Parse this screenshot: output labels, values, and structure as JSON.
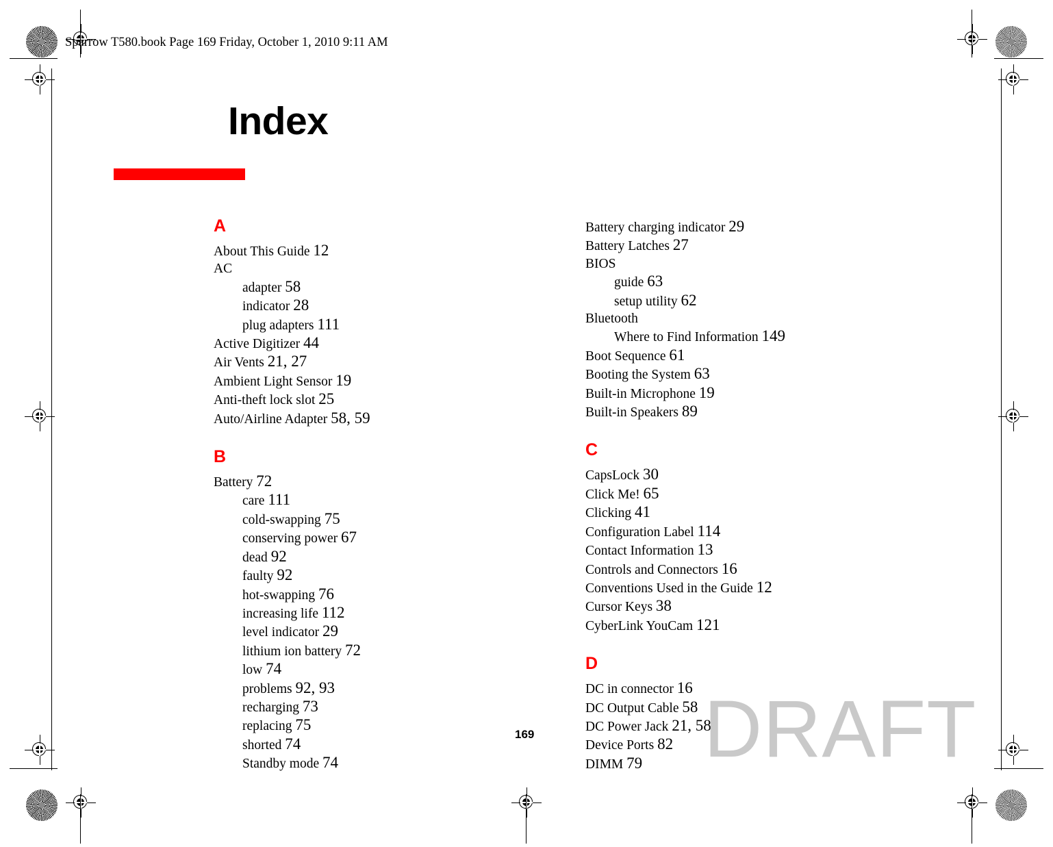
{
  "document": {
    "header": "Sparrow T580.book  Page 169  Friday, October 1, 2010  9:11 AM",
    "title": "Index",
    "folio": "169",
    "watermark": "DRAFT",
    "accent_color": "#ff0000",
    "watermark_color": "#c9c9c9"
  },
  "index": {
    "left_column": [
      {
        "letter": "A",
        "entries": [
          {
            "text": "About This Guide ",
            "pages": "12",
            "level": "main"
          },
          {
            "text": "AC",
            "pages": "",
            "level": "main"
          },
          {
            "text": "adapter ",
            "pages": "58",
            "level": "sub"
          },
          {
            "text": "indicator ",
            "pages": "28",
            "level": "sub"
          },
          {
            "text": "plug adapters ",
            "pages": "111",
            "level": "sub"
          },
          {
            "text": "Active Digitizer ",
            "pages": "44",
            "level": "main"
          },
          {
            "text": "Air Vents ",
            "pages": "21, 27",
            "level": "main"
          },
          {
            "text": "Ambient Light Sensor ",
            "pages": "19",
            "level": "main"
          },
          {
            "text": "Anti-theft lock slot ",
            "pages": "25",
            "level": "main"
          },
          {
            "text": "Auto/Airline Adapter ",
            "pages": "58, 59",
            "level": "main"
          }
        ]
      },
      {
        "letter": "B",
        "entries": [
          {
            "text": "Battery ",
            "pages": "72",
            "level": "main"
          },
          {
            "text": "care ",
            "pages": "111",
            "level": "sub"
          },
          {
            "text": "cold-swapping ",
            "pages": "75",
            "level": "sub"
          },
          {
            "text": "conserving power ",
            "pages": "67",
            "level": "sub"
          },
          {
            "text": "dead ",
            "pages": "92",
            "level": "sub"
          },
          {
            "text": "faulty ",
            "pages": "92",
            "level": "sub"
          },
          {
            "text": "hot-swapping ",
            "pages": "76",
            "level": "sub"
          },
          {
            "text": "increasing life ",
            "pages": "112",
            "level": "sub"
          },
          {
            "text": "level indicator ",
            "pages": "29",
            "level": "sub"
          },
          {
            "text": "lithium ion battery ",
            "pages": "72",
            "level": "sub"
          },
          {
            "text": "low ",
            "pages": "74",
            "level": "sub"
          },
          {
            "text": "problems ",
            "pages": "92, 93",
            "level": "sub"
          },
          {
            "text": "recharging ",
            "pages": "73",
            "level": "sub"
          },
          {
            "text": "replacing ",
            "pages": "75",
            "level": "sub"
          },
          {
            "text": "shorted ",
            "pages": "74",
            "level": "sub"
          },
          {
            "text": "Standby mode ",
            "pages": "74",
            "level": "sub"
          }
        ]
      }
    ],
    "right_column": [
      {
        "letter": "",
        "entries": [
          {
            "text": "Battery charging indicator ",
            "pages": "29",
            "level": "main"
          },
          {
            "text": "Battery Latches ",
            "pages": "27",
            "level": "main"
          },
          {
            "text": "BIOS",
            "pages": "",
            "level": "main"
          },
          {
            "text": "guide ",
            "pages": "63",
            "level": "sub"
          },
          {
            "text": "setup utility ",
            "pages": "62",
            "level": "sub"
          },
          {
            "text": "Bluetooth",
            "pages": "",
            "level": "main"
          },
          {
            "text": "Where to Find Information ",
            "pages": "149",
            "level": "sub"
          },
          {
            "text": "Boot Sequence ",
            "pages": "61",
            "level": "main"
          },
          {
            "text": "Booting the System ",
            "pages": "63",
            "level": "main"
          },
          {
            "text": "Built-in Microphone ",
            "pages": "19",
            "level": "main"
          },
          {
            "text": "Built-in Speakers ",
            "pages": "89",
            "level": "main"
          }
        ]
      },
      {
        "letter": "C",
        "entries": [
          {
            "text": "CapsLock ",
            "pages": "30",
            "level": "main"
          },
          {
            "text": "Click Me! ",
            "pages": "65",
            "level": "main"
          },
          {
            "text": "Clicking ",
            "pages": "41",
            "level": "main"
          },
          {
            "text": "Configuration Label ",
            "pages": "114",
            "level": "main"
          },
          {
            "text": "Contact Information ",
            "pages": "13",
            "level": "main"
          },
          {
            "text": "Controls and Connectors ",
            "pages": "16",
            "level": "main"
          },
          {
            "text": "Conventions Used in the Guide ",
            "pages": "12",
            "level": "main"
          },
          {
            "text": "Cursor Keys ",
            "pages": "38",
            "level": "main"
          },
          {
            "text": "CyberLink YouCam ",
            "pages": "121",
            "level": "main"
          }
        ]
      },
      {
        "letter": "D",
        "entries": [
          {
            "text": "DC in connector ",
            "pages": "16",
            "level": "main"
          },
          {
            "text": "DC Output Cable ",
            "pages": "58",
            "level": "main"
          },
          {
            "text": "DC Power Jack ",
            "pages": "21, 58",
            "level": "main"
          },
          {
            "text": "Device Ports ",
            "pages": "82",
            "level": "main"
          },
          {
            "text": "DIMM ",
            "pages": "79",
            "level": "main"
          }
        ]
      }
    ]
  }
}
